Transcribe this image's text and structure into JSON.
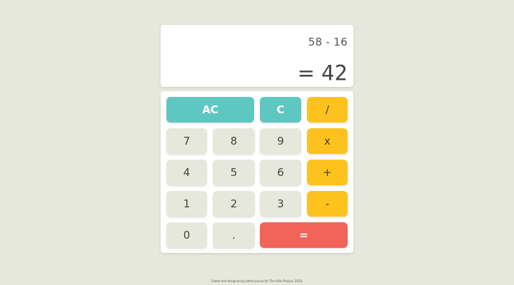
{
  "display": {
    "expression": "58 - 16",
    "result": "= 42"
  },
  "keys": {
    "ac": "AC",
    "c": "C",
    "divide": "/",
    "multiply": "x",
    "add": "+",
    "subtract": "-",
    "equals": "=",
    "dot": ".",
    "n0": "0",
    "n1": "1",
    "n2": "2",
    "n3": "3",
    "n4": "4",
    "n5": "5",
    "n6": "6",
    "n7": "7",
    "n8": "8",
    "n9": "9"
  },
  "footer": {
    "credit": "Coded and designed by Jethro Jovino for The Odin Project, 2024."
  },
  "colors": {
    "background": "#e6e8db",
    "teal": "#5fc7c1",
    "yellow": "#fdc21e",
    "red": "#f26358",
    "number_key": "#e6e8db"
  }
}
